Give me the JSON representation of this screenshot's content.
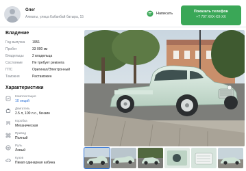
{
  "seller": {
    "name": "Олег",
    "address": "Алматы, улица Кабанбай батыра, 15"
  },
  "actions": {
    "write_label": "Написать",
    "phone_label": "Показать телефон",
    "phone_masked": "+7 707 XXX-XX-XX"
  },
  "ownership": {
    "title": "Владение",
    "rows": [
      {
        "key": "Год выпуска",
        "value": "1951"
      },
      {
        "key": "Пробег",
        "value": "33 000 км"
      },
      {
        "key": "Владельцы",
        "value": "2 владельца"
      },
      {
        "key": "Состояние",
        "value": "Не требует ремонта"
      },
      {
        "key": "ПТС",
        "value": "Оригинал/Электронный"
      },
      {
        "key": "Таможня",
        "value": "Растаможен"
      }
    ]
  },
  "specs": {
    "title": "Характеристики",
    "items": [
      {
        "label": "Комплектация",
        "value": "10 опций",
        "icon": "equipment-icon"
      },
      {
        "label": "Двигатель",
        "value": "2.5 л, 100 л.с., бензин",
        "icon": "engine-icon"
      },
      {
        "label": "Коробка",
        "value": "Механическая",
        "icon": "gearbox-icon"
      },
      {
        "label": "Привод",
        "value": "Полный",
        "icon": "drive-icon"
      },
      {
        "label": "Руль",
        "value": "Левый",
        "icon": "steering-wheel-icon"
      },
      {
        "label": "Кузов",
        "value": "Пикап одинарная кабина",
        "icon": "body-icon"
      }
    ]
  },
  "gallery": {
    "photo_count_visible": 6,
    "colors": {
      "car": "#cfe3d6",
      "sky": "#b8c9d6",
      "tree": "#4e6a3a",
      "road": "#7b7b78"
    }
  }
}
